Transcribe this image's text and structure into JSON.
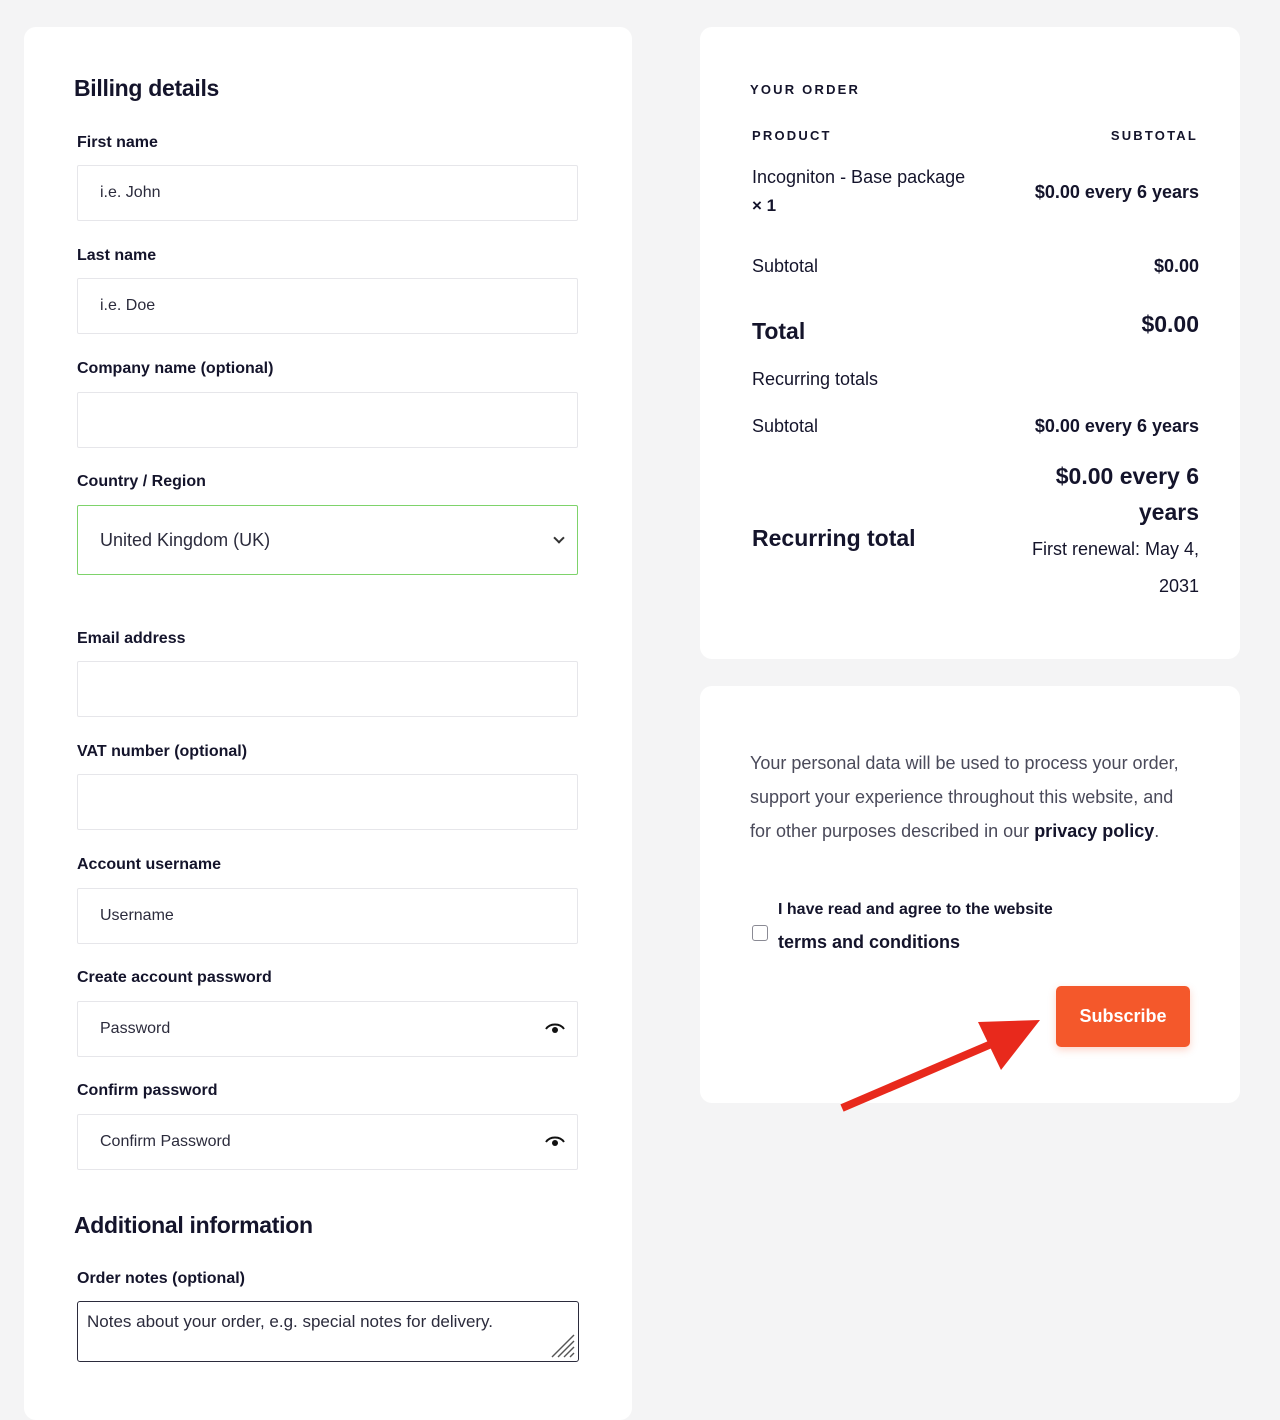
{
  "billing": {
    "title": "Billing details",
    "first_name": {
      "label": "First name",
      "placeholder": "i.e. John"
    },
    "last_name": {
      "label": "Last name",
      "placeholder": "i.e. Doe"
    },
    "company": {
      "label": "Company name (optional)",
      "placeholder": ""
    },
    "country": {
      "label": "Country / Region",
      "value": "United Kingdom (UK)"
    },
    "email": {
      "label": "Email address",
      "placeholder": ""
    },
    "vat": {
      "label": "VAT number (optional)",
      "placeholder": ""
    },
    "username": {
      "label": "Account username",
      "placeholder": "Username"
    },
    "password": {
      "label": "Create account password",
      "placeholder": "Password"
    },
    "confirm": {
      "label": "Confirm password",
      "placeholder": "Confirm Password"
    }
  },
  "additional": {
    "title": "Additional information",
    "notes": {
      "label": "Order notes (optional)",
      "placeholder": "Notes about your order, e.g. special notes for delivery."
    }
  },
  "order": {
    "title": "YOUR ORDER",
    "col_product": "PRODUCT",
    "col_subtotal": "SUBTOTAL",
    "product_name": "Incogniton - Base package",
    "product_qty": "× 1",
    "product_price": "$0.00 every 6 years",
    "subtotal_label": "Subtotal",
    "subtotal_value": "$0.00",
    "total_label": "Total",
    "total_value": "$0.00",
    "recurring_label": "Recurring totals",
    "recurring_subtotal_label": "Subtotal",
    "recurring_subtotal_value": "$0.00 every 6 years",
    "recurring_total_label": "Recurring total",
    "recurring_total_value_1": "$0.00 every 6",
    "recurring_total_value_2": "years",
    "renewal_1": "First renewal: May 4,",
    "renewal_2": "2031"
  },
  "terms": {
    "privacy_text": "Your personal data will be used to process your order, support your experience throughout this website, and for other purposes described in our",
    "privacy_link": "privacy policy",
    "privacy_end": ".",
    "agree_text": "I have read and agree to the website",
    "terms_link": "terms and conditions",
    "subscribe_label": "Subscribe"
  },
  "colors": {
    "accent": "#f4582b",
    "arrow": "#e8291c",
    "select_border": "#7ed36b"
  }
}
